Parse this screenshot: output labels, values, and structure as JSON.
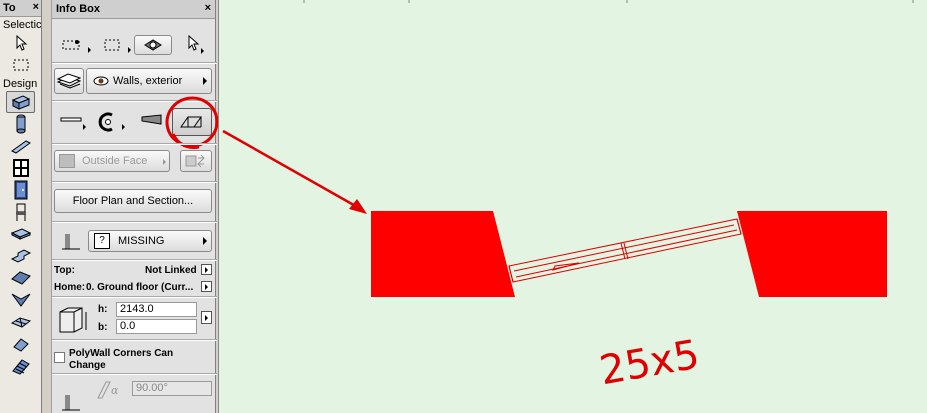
{
  "toolbox": {
    "title": "To",
    "close": "×",
    "section_selection": "Selectic",
    "section_design": "Design"
  },
  "infobox": {
    "title": "Info Box",
    "close": "×",
    "layer_name": "Walls, exterior",
    "surface_label": "Outside Face",
    "floorplan_button": "Floor Plan and Section...",
    "material_value": "MISSING",
    "material_prefix": "?",
    "top_label": "Top:",
    "top_value": "Not Linked",
    "home_label": "Home:",
    "home_value": "0. Ground floor (Curr...",
    "h_label": "h:",
    "h_value": "2143.0",
    "b_label": "b:",
    "b_value": "0.0",
    "polywall_label": "PolyWall Corners Can Change",
    "angle_value": "90.00°"
  },
  "annotation": {
    "handwritten_text": "25x5",
    "accent_color": "#e00000"
  },
  "colors": {
    "wall_fill": "#ff0000",
    "canvas_bg": "#e4f4e2",
    "panel_bg": "#e2e2e2"
  }
}
